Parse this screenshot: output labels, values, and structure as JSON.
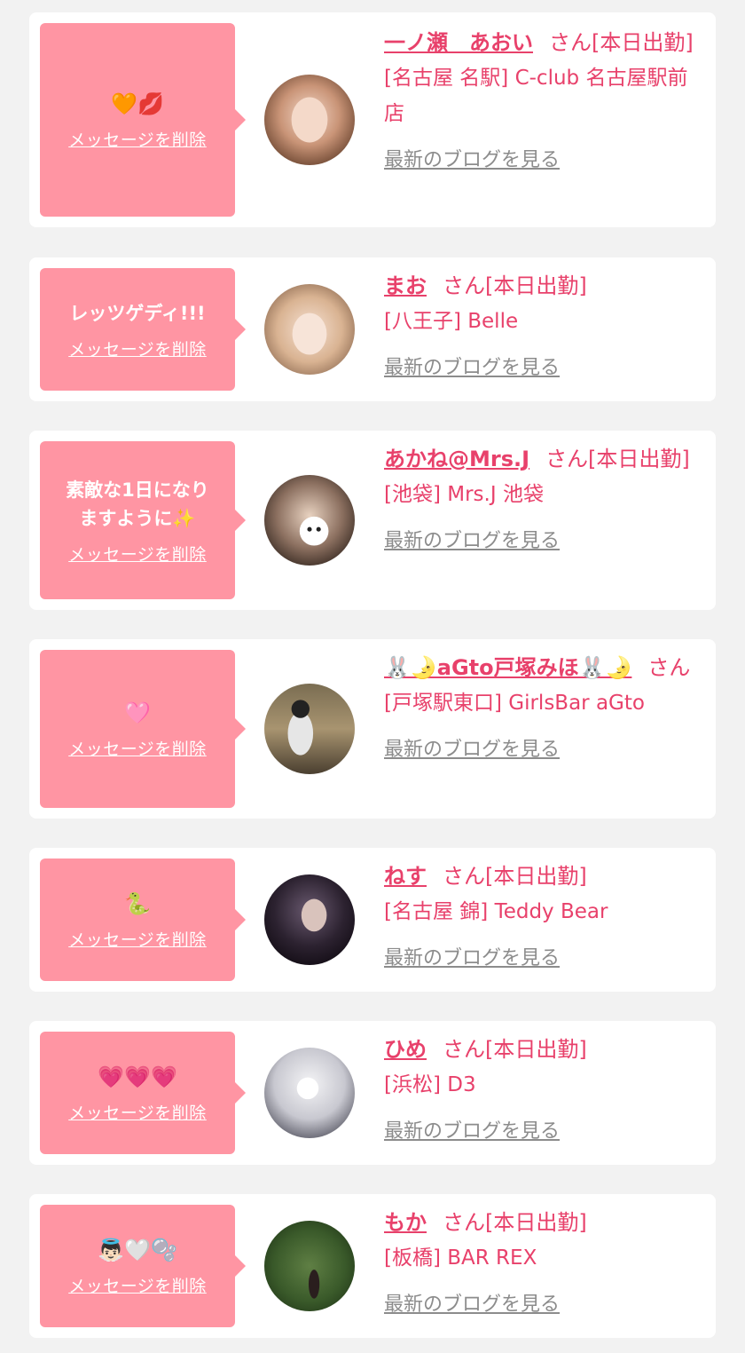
{
  "delete_label": "メッセージを削除",
  "blog_label": "最新のブログを見る",
  "san_suffix": "さん[本日出勤]",
  "cards": [
    {
      "message": "🧡💋",
      "name": "一ノ瀬　あおい",
      "suffix": "さん[本日出勤]",
      "shop": "[名古屋 名駅] C-club 名古屋駅前店"
    },
    {
      "message": "レッツゲディ!!!",
      "name": "まお",
      "suffix": "さん[本日出勤]",
      "shop": "[八王子] Belle"
    },
    {
      "message": "素敵な1日になりますように✨",
      "name": "あかね@Mrs.J",
      "suffix": "さん[本日出勤]",
      "shop": "[池袋] Mrs.J 池袋"
    },
    {
      "message": "🩷",
      "name": "🐰🌛aGto戸塚みほ🐰🌛",
      "suffix": "さん",
      "shop": "[戸塚駅東口] GirlsBar aGto"
    },
    {
      "message": "🐍",
      "name": "ねす",
      "suffix": "さん[本日出勤]",
      "shop": "[名古屋 錦] Teddy Bear"
    },
    {
      "message": "💗💗💗",
      "name": "ひめ",
      "suffix": "さん[本日出勤]",
      "shop": "[浜松] D3"
    },
    {
      "message": "👼🏻🤍🫧",
      "name": "もか",
      "suffix": "さん[本日出勤]",
      "shop": "[板橋] BAR REX"
    }
  ],
  "colors": {
    "page_bg": "#f2f2f2",
    "bubble": "#ff95a3",
    "accent": "#e8416b",
    "muted": "#8c8c8c"
  }
}
